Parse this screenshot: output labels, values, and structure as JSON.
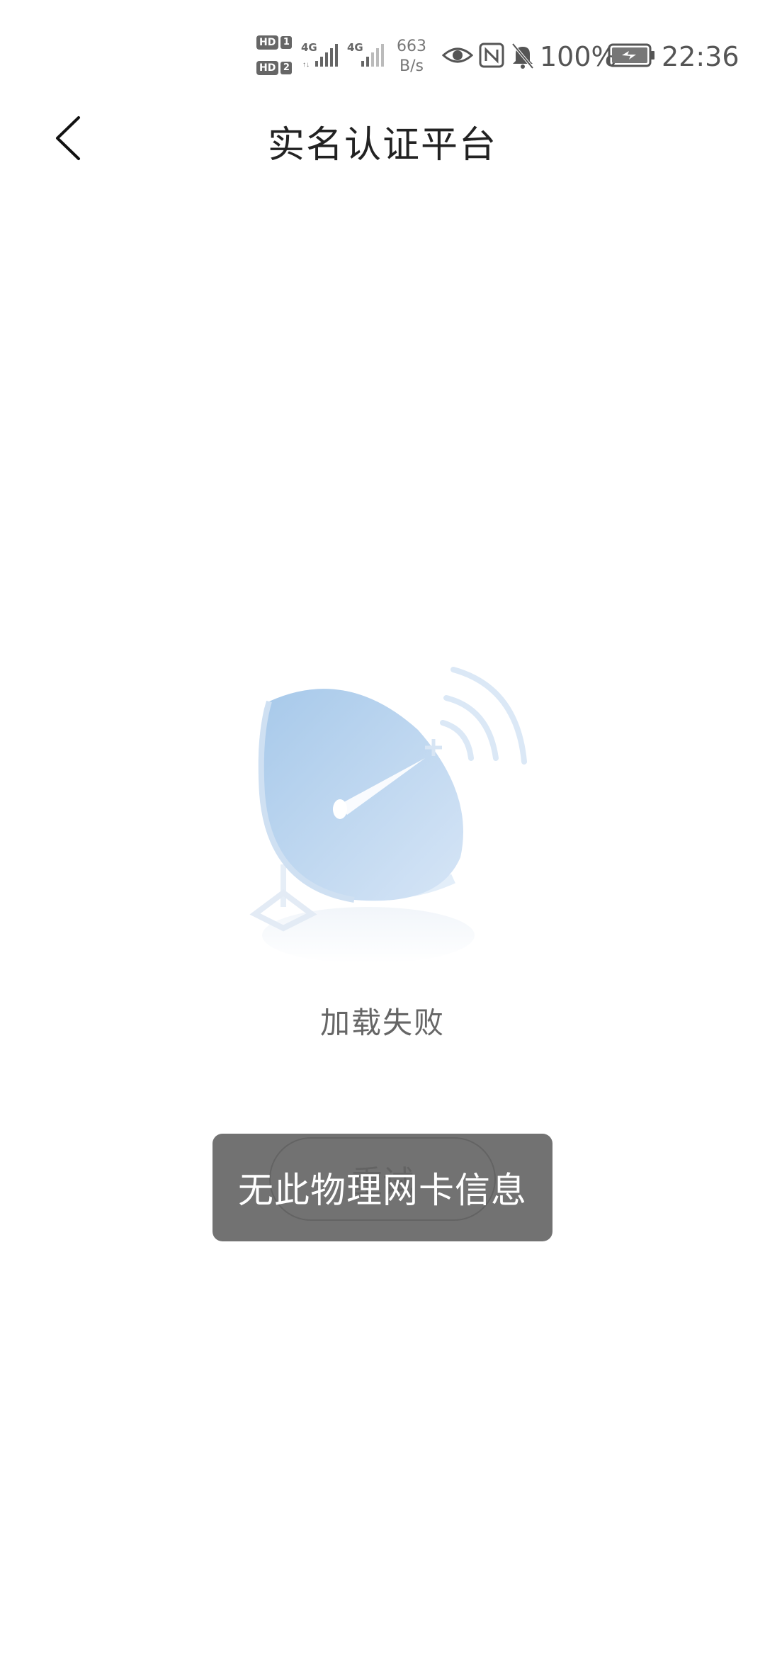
{
  "status_bar": {
    "sim1_badge": "HD",
    "sim1_number": "1",
    "sim2_badge": "HD",
    "sim2_number": "2",
    "signal1_network": "4G",
    "signal2_network": "4G",
    "net_speed_value": "663",
    "net_speed_unit": "B/s",
    "battery_percent": "100%",
    "time": "22:36",
    "icons": [
      "eye-icon",
      "nfc-icon",
      "bell-muted-icon",
      "battery-charging-icon"
    ]
  },
  "header": {
    "title": "实名认证平台",
    "back_icon": "chevron-left-icon"
  },
  "main": {
    "illustration": "satellite-dish-icon",
    "error_message": "加载失败",
    "retry_label": "重试"
  },
  "toast": {
    "message": "无此物理网卡信息"
  },
  "colors": {
    "dish_light": "#dbe9f8",
    "dish_dark": "#a9cbea",
    "toast_bg": "#666666",
    "text_muted": "#666666"
  }
}
